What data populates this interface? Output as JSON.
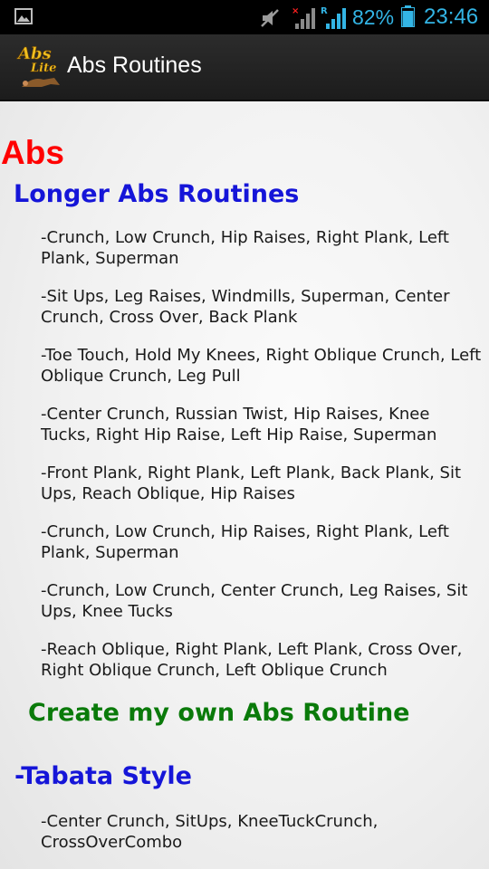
{
  "status_bar": {
    "battery_percent": "82%",
    "time": "23:46",
    "icons": [
      "picture-icon",
      "mute-icon",
      "signal-no-data-icon",
      "signal-roaming-icon",
      "battery-icon"
    ],
    "accent_color": "#33b5e5"
  },
  "action_bar": {
    "logo_text_top": "Abs",
    "logo_text_bottom": "Lite",
    "title": "Abs Routines"
  },
  "content": {
    "section_title": "Abs",
    "longer_heading": "Longer Abs Routines",
    "routines": [
      "-Crunch, Low Crunch, Hip Raises, Right Plank, Left Plank, Superman",
      "-Sit Ups, Leg Raises, Windmills, Superman, Center Crunch, Cross Over, Back Plank",
      "-Toe Touch, Hold My Knees, Right Oblique Crunch, Left Oblique Crunch, Leg Pull",
      "-Center Crunch, Russian Twist, Hip Raises, Knee Tucks, Right Hip Raise, Left Hip Raise, Superman",
      "-Front Plank, Right Plank, Left Plank, Back Plank, Sit Ups, Reach Oblique, Hip Raises",
      "-Crunch, Low Crunch, Hip Raises, Right Plank, Left Plank, Superman",
      "-Crunch, Low Crunch, Center Crunch, Leg Raises, Sit Ups, Knee Tucks",
      "-Reach Oblique, Right Plank, Left Plank, Cross Over, Right Oblique Crunch, Left Oblique Crunch"
    ],
    "create_own_label": "Create my own Abs Routine",
    "tabata_heading": "-Tabata Style",
    "tabata_routines": [
      "-Center Crunch, SitUps, KneeTuckCrunch, CrossOverCombo"
    ],
    "colors": {
      "section_title": "#ff0000",
      "heading": "#1515d8",
      "create_link": "#0a7a0a"
    }
  }
}
